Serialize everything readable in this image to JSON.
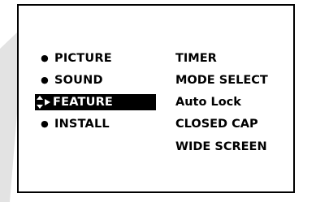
{
  "menu": {
    "main_items": [
      {
        "label": "PICTURE",
        "selected": false
      },
      {
        "label": "SOUND",
        "selected": false
      },
      {
        "label": "FEATURE",
        "selected": true
      },
      {
        "label": "INSTALL",
        "selected": false
      }
    ],
    "sub_items": [
      {
        "label": "TIMER"
      },
      {
        "label": "MODE SELECT"
      },
      {
        "label": "Auto Lock"
      },
      {
        "label": "CLOSED CAP"
      },
      {
        "label": "WIDE SCREEN"
      }
    ],
    "bullet_glyph": "●",
    "cursor_icon": "up-down-right-arrow-icon"
  },
  "colors": {
    "background": "#ffffff",
    "border": "#000000",
    "text": "#000000",
    "highlight_bg": "#000000",
    "highlight_text": "#ffffff",
    "side_shade": "#e3e3e3"
  }
}
